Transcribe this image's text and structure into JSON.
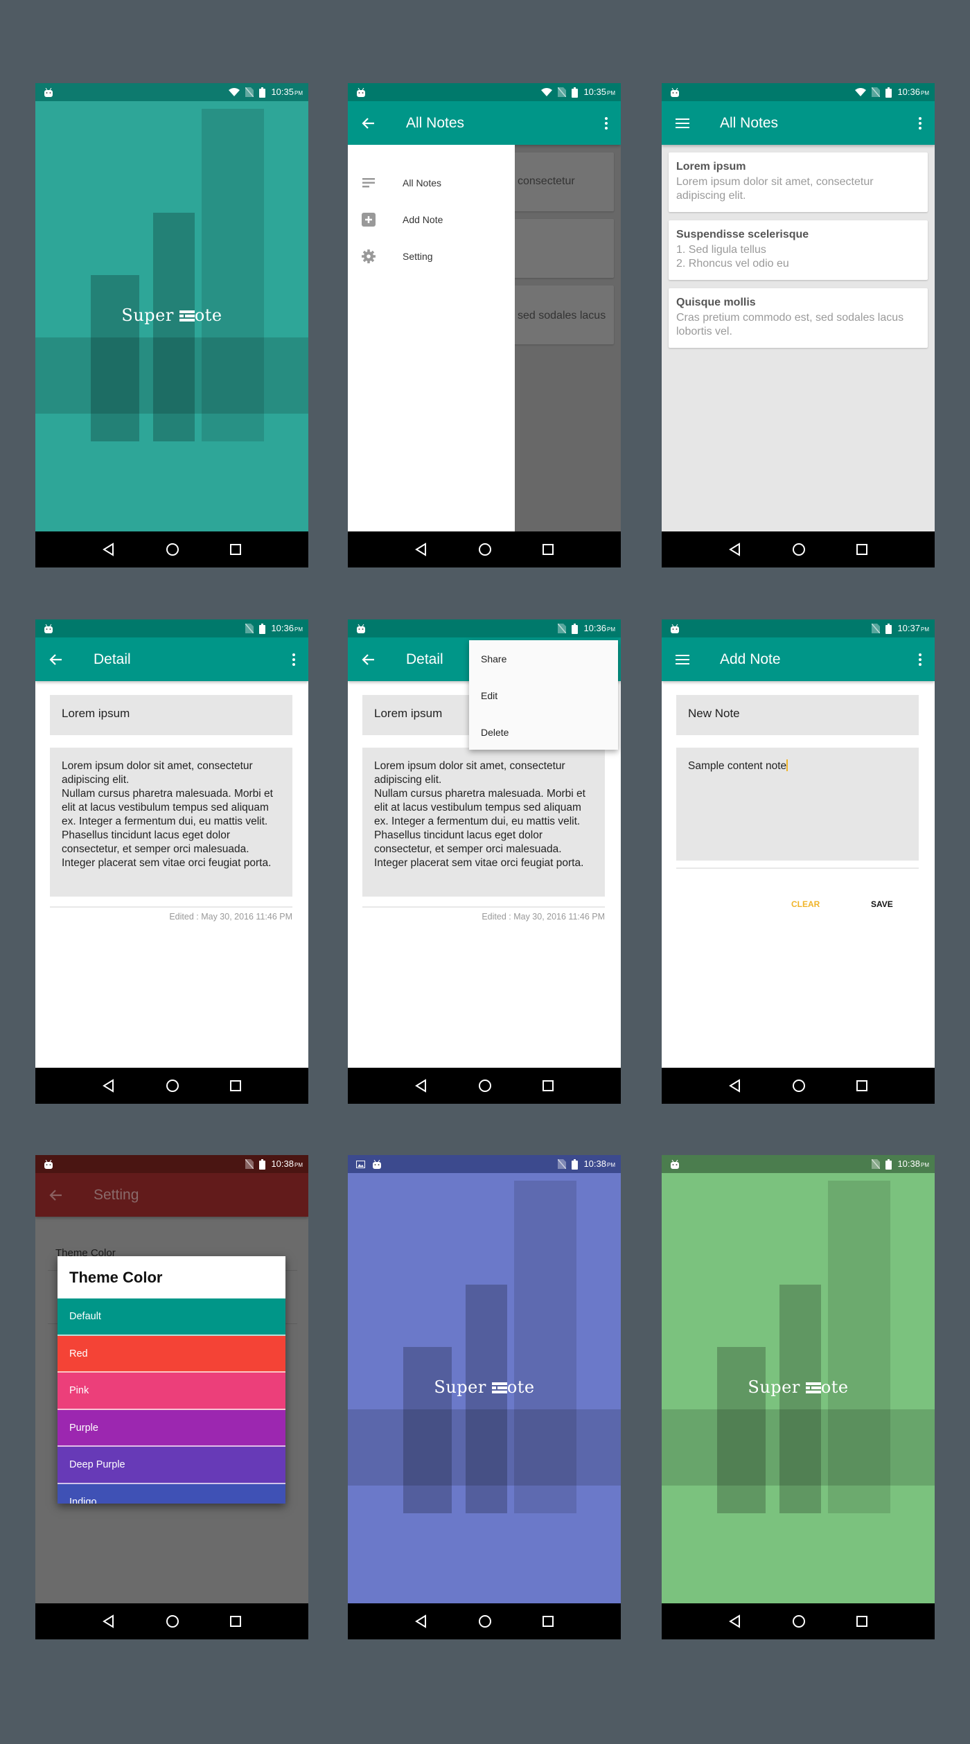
{
  "screens": [
    {
      "status": {
        "time": "10:35",
        "ampm": "PM",
        "wifi": true,
        "image_icon": false,
        "bar_color": "#0d7a6e"
      },
      "splash": {
        "logo_text": "Super Note",
        "logo_prefix": "Super",
        "logo_suffix": "ote",
        "tint": "#2ea698"
      }
    },
    {
      "status": {
        "time": "10:35",
        "ampm": "PM",
        "wifi": true,
        "image_icon": false,
        "bar_color": "#00796b"
      },
      "appbar": {
        "title": "All Notes",
        "nav_icon": "arrow-back-icon"
      },
      "drawer": {
        "items": [
          {
            "label": "All Notes",
            "icon": "notes-list-icon"
          },
          {
            "label": "Add Note",
            "icon": "add-box-icon"
          },
          {
            "label": "Setting",
            "icon": "gear-icon"
          }
        ]
      },
      "background_snippets": [
        "consectetur",
        "sed sodales lacus"
      ]
    },
    {
      "status": {
        "time": "10:36",
        "ampm": "PM",
        "wifi": true,
        "image_icon": false,
        "bar_color": "#00796b"
      },
      "appbar": {
        "title": "All Notes",
        "nav_icon": "menu-icon"
      },
      "notes": [
        {
          "title": "Lorem ipsum",
          "body": "Lorem ipsum dolor sit amet, consectetur adipiscing elit."
        },
        {
          "title": "Suspendisse scelerisque",
          "body": "1. Sed ligula tellus\n2. Rhoncus vel odio eu"
        },
        {
          "title": "Quisque mollis",
          "body": "Cras pretium commodo est, sed sodales lacus lobortis vel."
        }
      ]
    },
    {
      "status": {
        "time": "10:36",
        "ampm": "PM",
        "wifi": false,
        "image_icon": false,
        "bar_color": "#00796b"
      },
      "appbar": {
        "title": "Detail",
        "nav_icon": "arrow-back-icon"
      },
      "detail": {
        "title": "Lorem ipsum",
        "body": "Lorem ipsum dolor sit amet, consectetur adipiscing elit.\nNullam cursus pharetra malesuada. Morbi et elit at lacus vestibulum tempus sed aliquam ex. Integer a fermentum dui, eu mattis velit. Phasellus tincidunt lacus eget dolor consectetur, et semper orci malesuada. Integer placerat sem vitae orci feugiat porta.",
        "edited": "Edited : May 30, 2016 11:46 PM"
      }
    },
    {
      "status": {
        "time": "10:36",
        "ampm": "PM",
        "wifi": false,
        "image_icon": false,
        "bar_color": "#00796b"
      },
      "appbar": {
        "title": "Detail",
        "nav_icon": "arrow-back-icon"
      },
      "detail": {
        "title": "Lorem ipsum",
        "body": "Lorem ipsum dolor sit amet, consectetur adipiscing elit.\nNullam cursus pharetra malesuada. Morbi et elit at lacus vestibulum tempus sed aliquam ex. Integer a fermentum dui, eu mattis velit. Phasellus tincidunt lacus eget dolor consectetur, et semper orci malesuada. Integer placerat sem vitae orci feugiat porta.",
        "edited": "Edited : May 30, 2016 11:46 PM"
      },
      "menu": {
        "items": [
          "Share",
          "Edit",
          "Delete"
        ]
      }
    },
    {
      "status": {
        "time": "10:37",
        "ampm": "PM",
        "wifi": false,
        "image_icon": false,
        "bar_color": "#00796b"
      },
      "appbar": {
        "title": "Add Note",
        "nav_icon": "menu-icon"
      },
      "form": {
        "title_value": "New Note",
        "content_value": "Sample content note",
        "clear_label": "CLEAR",
        "save_label": "SAVE",
        "clear_color": "#f0b429"
      }
    },
    {
      "status": {
        "time": "10:38",
        "ampm": "PM",
        "wifi": false,
        "image_icon": false,
        "bar_color": "#4a1512"
      },
      "appbar": {
        "title": "Setting",
        "nav_icon": "arrow-back-icon"
      },
      "setting": {
        "label": "Theme Color"
      },
      "dialog": {
        "title": "Theme Color",
        "options": [
          {
            "label": "Default",
            "color": "#009688"
          },
          {
            "label": "Red",
            "color": "#f44336"
          },
          {
            "label": "Pink",
            "color": "#e91e63"
          },
          {
            "label": "Purple",
            "color": "#9c27b0"
          },
          {
            "label": "Deep Purple",
            "color": "#673ab7"
          },
          {
            "label": "Indigo",
            "color": "#3f51b5"
          }
        ]
      }
    },
    {
      "status": {
        "time": "10:38",
        "ampm": "PM",
        "wifi": false,
        "image_icon": true,
        "bar_color": "#3c4a8e"
      },
      "splash": {
        "logo_text": "Super Note",
        "logo_prefix": "Super",
        "logo_suffix": "ote",
        "tint": "#6b79c9"
      }
    },
    {
      "status": {
        "time": "10:38",
        "ampm": "PM",
        "wifi": false,
        "image_icon": false,
        "bar_color": "#4b7d4e"
      },
      "splash": {
        "logo_text": "Super Note",
        "logo_prefix": "Super",
        "logo_suffix": "ote",
        "tint": "#7bc27e"
      }
    }
  ]
}
